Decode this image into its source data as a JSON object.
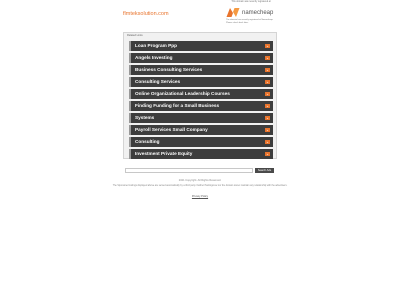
{
  "header": {
    "domain": "flmteksolution.com",
    "sale_note": "This domain was recently registered at",
    "registrar_name": "namecheap",
    "registrar_description": "The domain has recently registered at Namecheap. Please check back later."
  },
  "related_links": {
    "title": "Related Links",
    "items": [
      {
        "label": "Loan Program Ppp"
      },
      {
        "label": "Angels Investing"
      },
      {
        "label": "Business Consulting Services"
      },
      {
        "label": "Consulting Services"
      },
      {
        "label": "Online Organizational Leadership Courses"
      },
      {
        "label": "Finding Funding for a Small Business"
      },
      {
        "label": "Systems"
      },
      {
        "label": "Payroll Services Small Company"
      },
      {
        "label": "Consulting"
      },
      {
        "label": "Investment Private Equity"
      }
    ],
    "arrow_glyph": "»"
  },
  "search": {
    "input_value": "",
    "button_label": "Search Ads"
  },
  "footer": {
    "copyright": "2021 Copyright. All Rights Reserved.",
    "disclaimer": "The Sponsored Listings displayed above are served automatically by a third party. Neither Parkingcrew nor the domain owner maintain any relationship with the advertisers.",
    "privacy_label": "Privacy Policy"
  },
  "colors": {
    "accent": "#e8742d",
    "link_bg": "#3d3d3d"
  },
  "icons": {
    "registrar_logo": "namecheap-logo-icon"
  }
}
